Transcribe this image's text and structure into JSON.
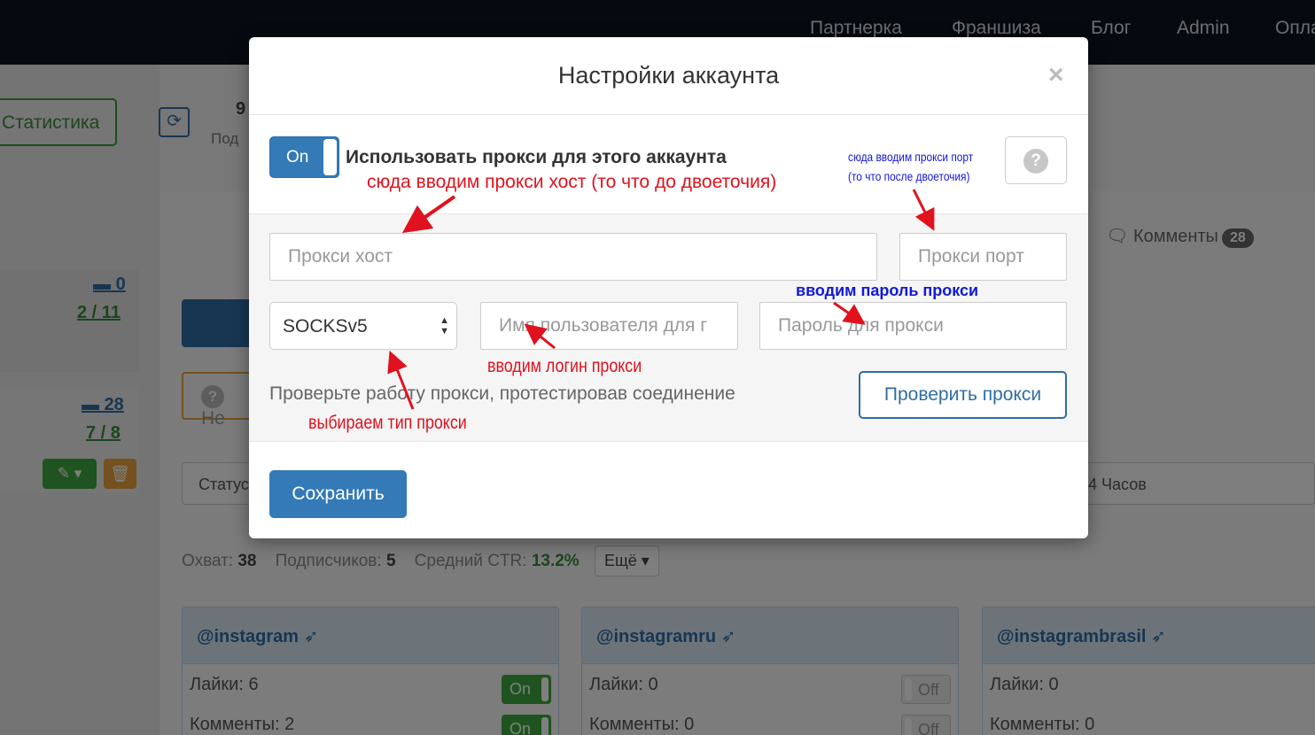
{
  "nav": {
    "items": [
      "Партнерка",
      "Франшиза",
      "Блог",
      "Admin",
      "Опла"
    ]
  },
  "background": {
    "stats_button": "Статистика",
    "stat_number": "9",
    "stat_sub": "Под",
    "counters": {
      "row1_comments": "0",
      "row1_ratio": "2 / 11",
      "row2_comments": "28",
      "row2_ratio": "7 / 8"
    },
    "orange_btn_text": "Не",
    "comments_tab": {
      "label": "Комменты",
      "count": "28"
    },
    "filter_status": "Статус",
    "filter_hours": "4 Часов",
    "stats": {
      "reach_label": "Охват:",
      "reach_value": "38",
      "subs_label": "Подписчиков:",
      "subs_value": "5",
      "ctr_label": "Средний CTR:",
      "ctr_value": "13.2%",
      "more": "Ещё"
    },
    "cards": [
      {
        "title": "@instagram",
        "likes": "Лайки: 6",
        "comments": "Комменты: 2",
        "likes_toggle": "On",
        "comments_toggle": "On"
      },
      {
        "title": "@instagramru",
        "likes": "Лайки: 0",
        "comments": "Комменты: 0",
        "likes_toggle": "Off",
        "comments_toggle": "Off"
      },
      {
        "title": "@instagrambrasil",
        "likes": "Лайки: 0",
        "comments": "Комменты: 0",
        "likes_toggle": "",
        "comments_toggle": ""
      }
    ]
  },
  "modal": {
    "title": "Настройки аккаунта",
    "close": "×",
    "toggle_label": "On",
    "use_proxy_label": "Использовать прокси для этого аккаунта",
    "help": "?",
    "proxy_host": {
      "value": "",
      "placeholder": "Прокси хост"
    },
    "proxy_port": {
      "value": "",
      "placeholder": "Прокси порт"
    },
    "proxy_type": "SOCKSv5",
    "proxy_user": {
      "value": "",
      "placeholder": "Имя пользователя для г"
    },
    "proxy_pass": {
      "value": "",
      "placeholder": "Пароль для прокси"
    },
    "check_text": "Проверьте работу прокси, протестировав соединение",
    "check_button": "Проверить прокси",
    "save_button": "Сохранить"
  },
  "annotations": {
    "host": "сюда вводим прокси хост (то что до двоеточия)",
    "port_line1": "сюда вводим прокси порт",
    "port_line2": "(то что после двоеточия)",
    "password": "вводим пароль прокси",
    "login": "вводим логин прокси",
    "type": "выбираем тип прокси"
  },
  "colors": {
    "primary": "#337ab7",
    "success": "#3fa63f",
    "warning": "#e8a33c",
    "annotation_red": "#e0121e",
    "annotation_blue": "#1219d8"
  }
}
